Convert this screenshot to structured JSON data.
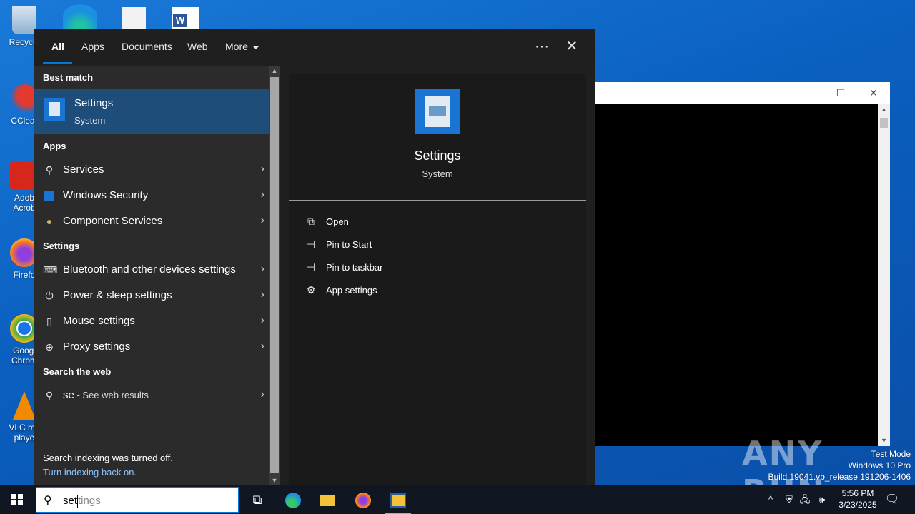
{
  "desktop": {
    "icons": [
      {
        "label": "Recycle",
        "icon": "recycle-bin-icon"
      },
      {
        "label": "CClear",
        "icon": "ccleaner-icon"
      },
      {
        "label": "Adob Acrob",
        "icon": "acrobat-icon"
      },
      {
        "label": "Firefo",
        "icon": "firefox-icon"
      },
      {
        "label": "Googl Chrom",
        "icon": "chrome-icon"
      },
      {
        "label": "VLC me playe",
        "icon": "vlc-icon"
      }
    ]
  },
  "watermark": {
    "brand": "ANY RUN",
    "line1": "Test Mode",
    "line2": "Windows 10 Pro",
    "line3": "Build 19041.vb_release.191206-1406"
  },
  "search_panel": {
    "tabs": [
      {
        "label": "All",
        "active": true
      },
      {
        "label": "Apps"
      },
      {
        "label": "Documents"
      },
      {
        "label": "Web"
      },
      {
        "label": "More"
      }
    ],
    "more_options_glyph": "···",
    "close_glyph": "✕",
    "sections": {
      "best_match": "Best match",
      "apps": "Apps",
      "settings": "Settings",
      "search_web": "Search the web"
    },
    "best_match": {
      "name": "Settings",
      "subtitle": "System"
    },
    "apps": [
      {
        "label": "Services",
        "icon": "gear-key-icon"
      },
      {
        "label": "Windows Security",
        "icon": "shield-icon"
      },
      {
        "label": "Component Services",
        "icon": "component-icon"
      }
    ],
    "settings": [
      {
        "label": "Bluetooth and other devices settings",
        "icon": "keyboard-icon"
      },
      {
        "label": "Power & sleep settings",
        "icon": "power-icon"
      },
      {
        "label": "Mouse settings",
        "icon": "mouse-icon"
      },
      {
        "label": "Proxy settings",
        "icon": "globe-icon"
      }
    ],
    "web": {
      "query": "se",
      "suffix": " - See web results"
    },
    "footer": {
      "line1": "Search indexing was turned off.",
      "line2": "Turn indexing back on."
    },
    "detail": {
      "name": "Settings",
      "subtitle": "System",
      "actions": [
        {
          "label": "Open",
          "icon": "open-icon"
        },
        {
          "label": "Pin to Start",
          "icon": "pin-icon"
        },
        {
          "label": "Pin to taskbar",
          "icon": "pin-icon"
        },
        {
          "label": "App settings",
          "icon": "gear-icon"
        }
      ]
    }
  },
  "taskbar": {
    "search_typed": "set",
    "search_ghost": "tings",
    "clock_time": "5:56 PM",
    "clock_date": "3/23/2025"
  }
}
